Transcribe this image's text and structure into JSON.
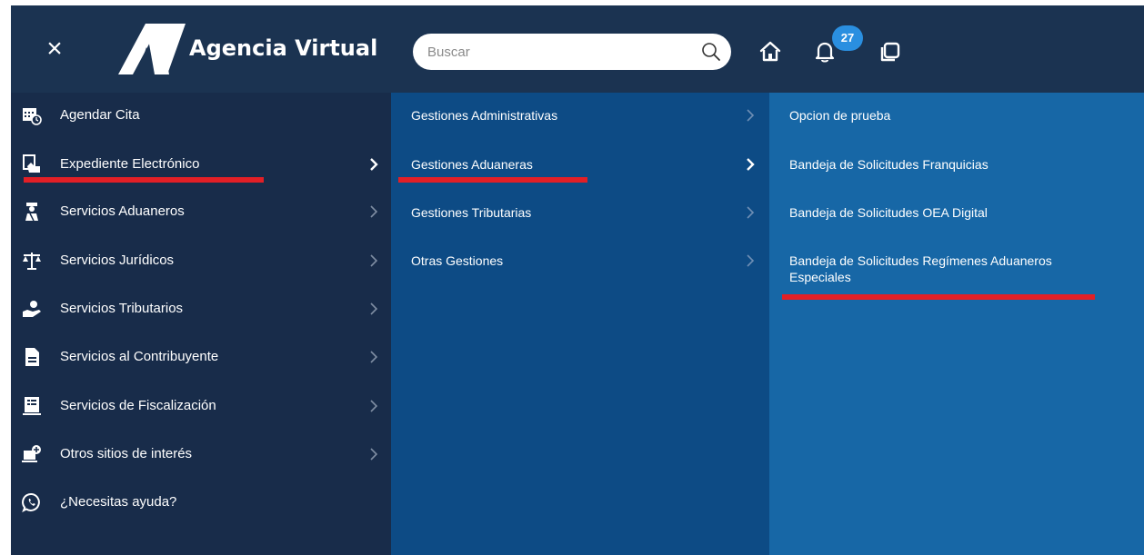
{
  "header": {
    "close_glyph": "×",
    "app_title": "Agencia Virtual",
    "search_placeholder": "Buscar",
    "notifications_count": "27"
  },
  "colors": {
    "header_bg": "#1b3351",
    "col1_bg": "#182c4a",
    "col2_bg": "#0d4b85",
    "col3_bg": "#1767a6",
    "badge": "#2a8fe0",
    "highlight_underline": "#e21f26"
  },
  "menu": {
    "items": [
      {
        "label": "Agendar Cita",
        "icon": "calendar-clock-icon",
        "has_submenu": false
      },
      {
        "label": "Expediente Electrónico",
        "icon": "hand-document-icon",
        "has_submenu": true,
        "active": true
      },
      {
        "label": "Servicios Aduaneros",
        "icon": "customs-officer-icon",
        "has_submenu": true
      },
      {
        "label": "Servicios Jurídicos",
        "icon": "scales-icon",
        "has_submenu": true
      },
      {
        "label": "Servicios Tributarios",
        "icon": "hand-coin-icon",
        "has_submenu": true
      },
      {
        "label": "Servicios al Contribuyente",
        "icon": "document-icon",
        "has_submenu": true
      },
      {
        "label": "Servicios de Fiscalización",
        "icon": "list-report-icon",
        "has_submenu": true
      },
      {
        "label": "Otros sitios de interés",
        "icon": "computer-add-icon",
        "has_submenu": true
      },
      {
        "label": "¿Necesitas ayuda?",
        "icon": "whatsapp-icon",
        "has_submenu": false
      }
    ]
  },
  "submenu": {
    "items": [
      {
        "label": "Gestiones Administrativas"
      },
      {
        "label": "Gestiones Aduaneras",
        "active": true
      },
      {
        "label": "Gestiones Tributarias"
      },
      {
        "label": "Otras Gestiones"
      }
    ]
  },
  "subsubmenu": {
    "items": [
      {
        "label": "Opcion de prueba"
      },
      {
        "label": "Bandeja de Solicitudes Franquicias"
      },
      {
        "label": "Bandeja de Solicitudes OEA Digital"
      },
      {
        "label": "Bandeja de Solicitudes Regímenes Aduaneros Especiales",
        "active": true
      }
    ]
  }
}
